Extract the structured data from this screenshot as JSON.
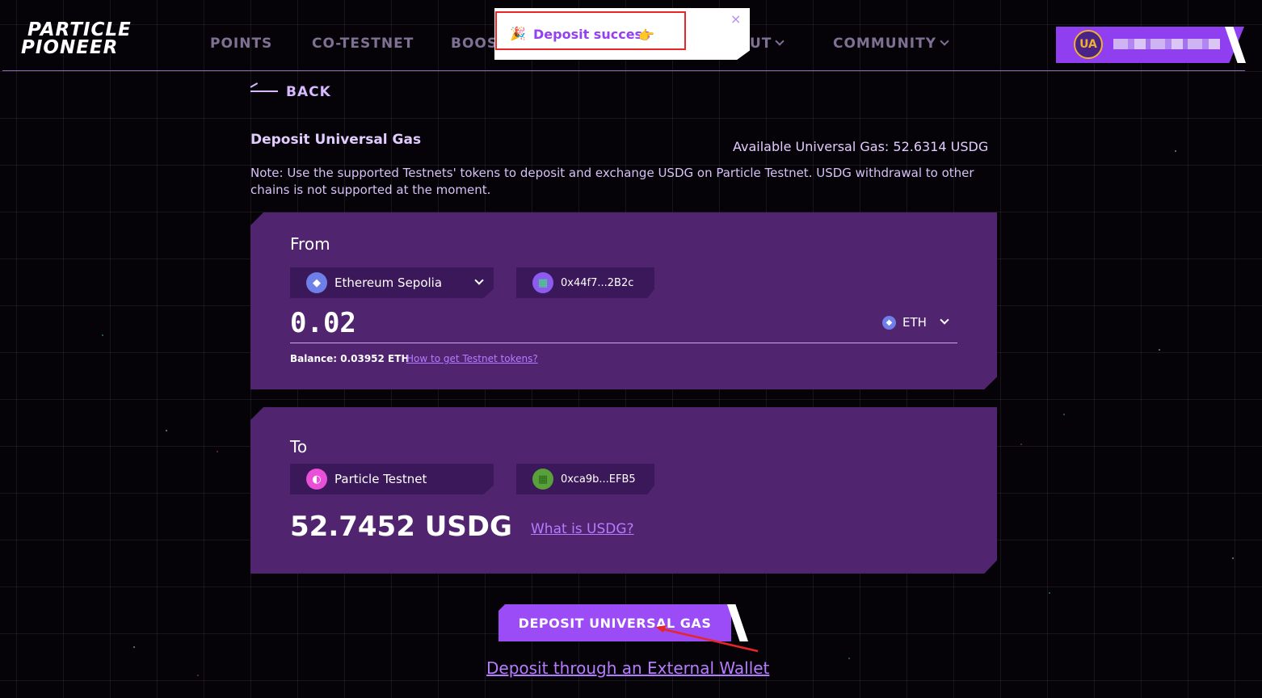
{
  "header": {
    "logo_line1": "PARTICLE",
    "logo_line2": "PIONEER",
    "nav": [
      {
        "label": "POINTS"
      },
      {
        "label": "CO-TESTNET"
      },
      {
        "label": "BOOS"
      },
      {
        "label": "UT"
      },
      {
        "label": "COMMUNITY"
      }
    ],
    "avatar_label": "UA"
  },
  "toast": {
    "message": "Deposit success",
    "close_glyph": "×"
  },
  "page": {
    "back_label": "BACK",
    "title": "Deposit Universal Gas",
    "available": "Available Universal Gas: 52.6314 USDG",
    "note": "Note: Use the supported Testnets' tokens to deposit and exchange USDG on Particle Testnet. USDG withdrawal to other chains is not supported at the moment."
  },
  "from": {
    "label": "From",
    "chain": "Ethereum Sepolia",
    "address": "0x44f7...2B2c",
    "amount": "0.02",
    "token": "ETH",
    "balance": "Balance: 0.03952 ETH",
    "testnet_link": "How to get Testnet tokens?"
  },
  "to": {
    "label": "To",
    "chain": "Particle Testnet",
    "address": "0xca9b...EFB5",
    "amount": "52.7452 USDG",
    "usdg_link": "What is USDG?"
  },
  "actions": {
    "deposit_button": "DEPOSIT UNIVERSAL GAS",
    "external_link": "Deposit through an External Wallet"
  },
  "colors": {
    "accent": "#9b4cf6",
    "card": "#50246f",
    "highlight": "#e8262a"
  }
}
